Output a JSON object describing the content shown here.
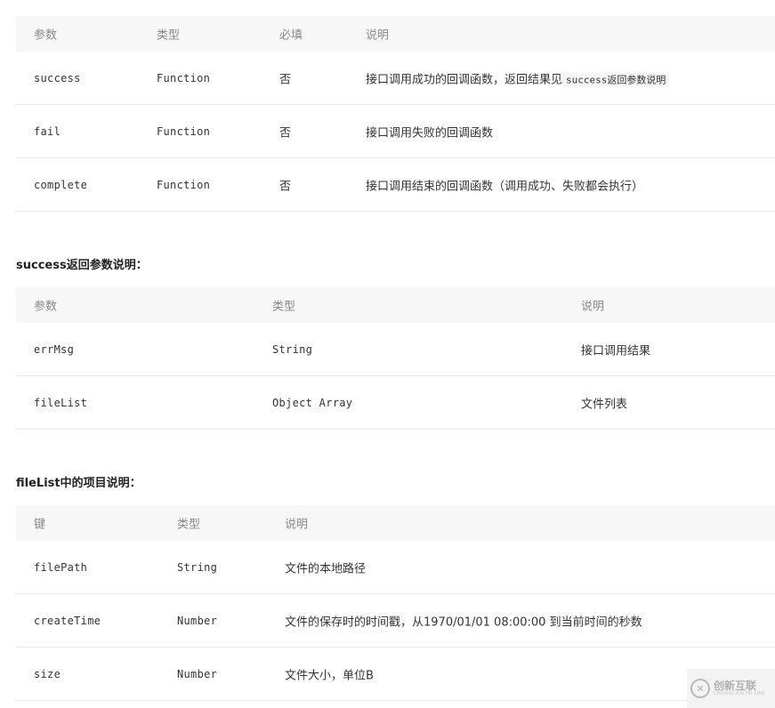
{
  "table1": {
    "headers": [
      "参数",
      "类型",
      "必填",
      "说明"
    ],
    "rows": [
      {
        "name": "success",
        "type": "Function",
        "required": "否",
        "desc_prefix": "接口调用成功的回调函数，返回结果见",
        "desc_code": "success返回参数说明"
      },
      {
        "name": "fail",
        "type": "Function",
        "required": "否",
        "desc": "接口调用失败的回调函数"
      },
      {
        "name": "complete",
        "type": "Function",
        "required": "否",
        "desc": "接口调用结束的回调函数（调用成功、失败都会执行）"
      }
    ]
  },
  "section2": {
    "title": "success返回参数说明："
  },
  "table2": {
    "headers": [
      "参数",
      "类型",
      "说明"
    ],
    "rows": [
      {
        "name": "errMsg",
        "type": "String",
        "desc": "接口调用结果"
      },
      {
        "name": "fileList",
        "type": "Object Array",
        "desc": "文件列表"
      }
    ]
  },
  "section3": {
    "title": "fileList中的项目说明："
  },
  "table3": {
    "headers": [
      "键",
      "类型",
      "说明"
    ],
    "rows": [
      {
        "name": "filePath",
        "type": "String",
        "desc": "文件的本地路径"
      },
      {
        "name": "createTime",
        "type": "Number",
        "desc": "文件的保存时的时间戳，从1970/01/01 08:00:00 到当前时间的秒数"
      },
      {
        "name": "size",
        "type": "Number",
        "desc": "文件大小，单位B"
      }
    ]
  },
  "watermark": {
    "logo_glyph": "✕",
    "main": "创新互联",
    "sub": "CHUANG XIN HU LIAN"
  }
}
